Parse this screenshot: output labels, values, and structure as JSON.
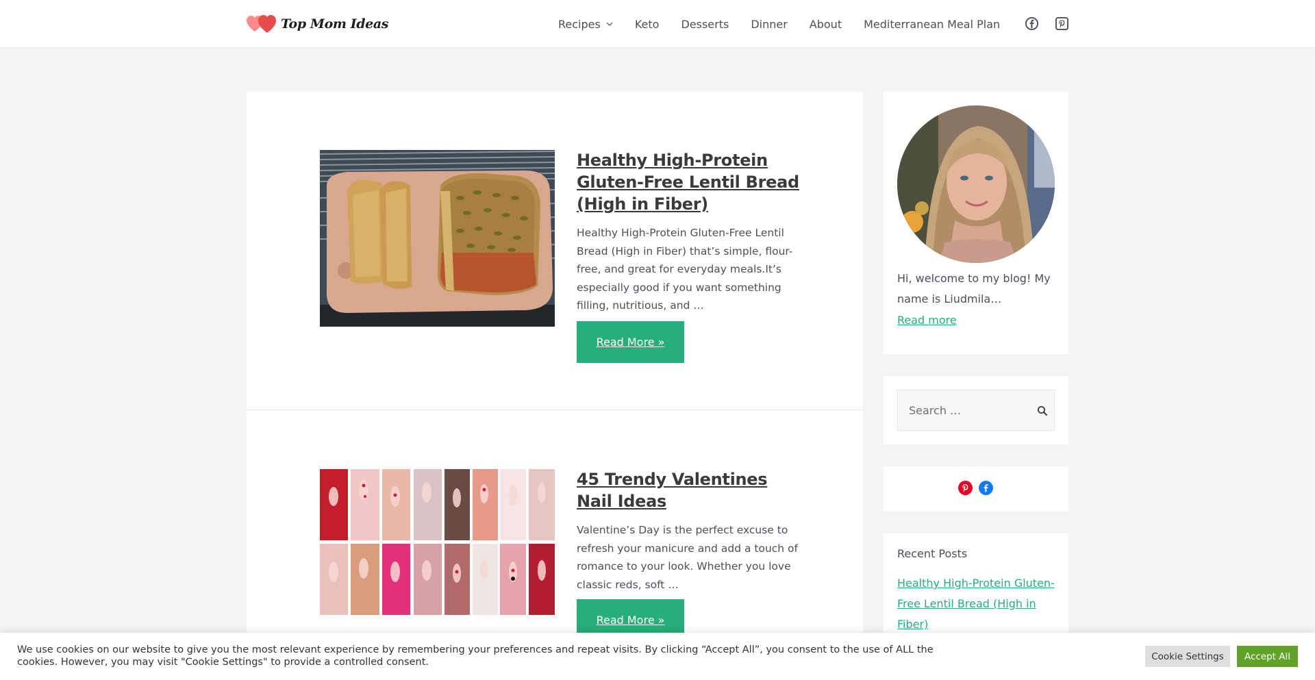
{
  "header": {
    "logo_text": "Top Mom Ideas",
    "nav": [
      {
        "label": "Recipes",
        "has_dropdown": true
      },
      {
        "label": "Keto"
      },
      {
        "label": "Desserts"
      },
      {
        "label": "Dinner"
      },
      {
        "label": "About"
      },
      {
        "label": "Mediterranean Meal Plan"
      }
    ],
    "social_icons": [
      "facebook-icon",
      "pinterest-icon"
    ]
  },
  "posts": [
    {
      "title": "Healthy High-Protein Gluten-Free Lentil Bread (High in Fiber)",
      "excerpt": "Healthy High-Protein Gluten-Free Lentil Bread (High in Fiber) that’s simple, flour-free, and great for everyday meals.It’s especially good if you want something filling, nutritious, and …",
      "read_more": "Read More »"
    },
    {
      "title": "45 Trendy Valentines Nail Ideas",
      "excerpt": "Valentine’s Day is the perfect excuse to refresh your manicure and add a touch of romance to your look. Whether you love classic reds, soft …",
      "read_more": "Read More »"
    }
  ],
  "sidebar": {
    "about_text": "Hi, welcome to my blog! My name is Liudmila…",
    "about_link": "Read more",
    "search_placeholder": "Search …",
    "recent_title": "Recent Posts",
    "recent_posts": [
      "Healthy High-Protein Gluten-Free Lentil Bread (High in Fiber)"
    ]
  },
  "cookie": {
    "text": "We use cookies on our website to give you the most relevant experience by remembering your preferences and repeat visits. By clicking “Accept All”, you consent to the use of ALL the cookies. However, you may visit \"Cookie Settings\" to provide a controlled consent.",
    "settings_label": "Cookie Settings",
    "accept_label": "Accept All"
  },
  "colors": {
    "accent": "#27ae7a",
    "accept": "#61a229",
    "background": "#f3f5f4"
  }
}
